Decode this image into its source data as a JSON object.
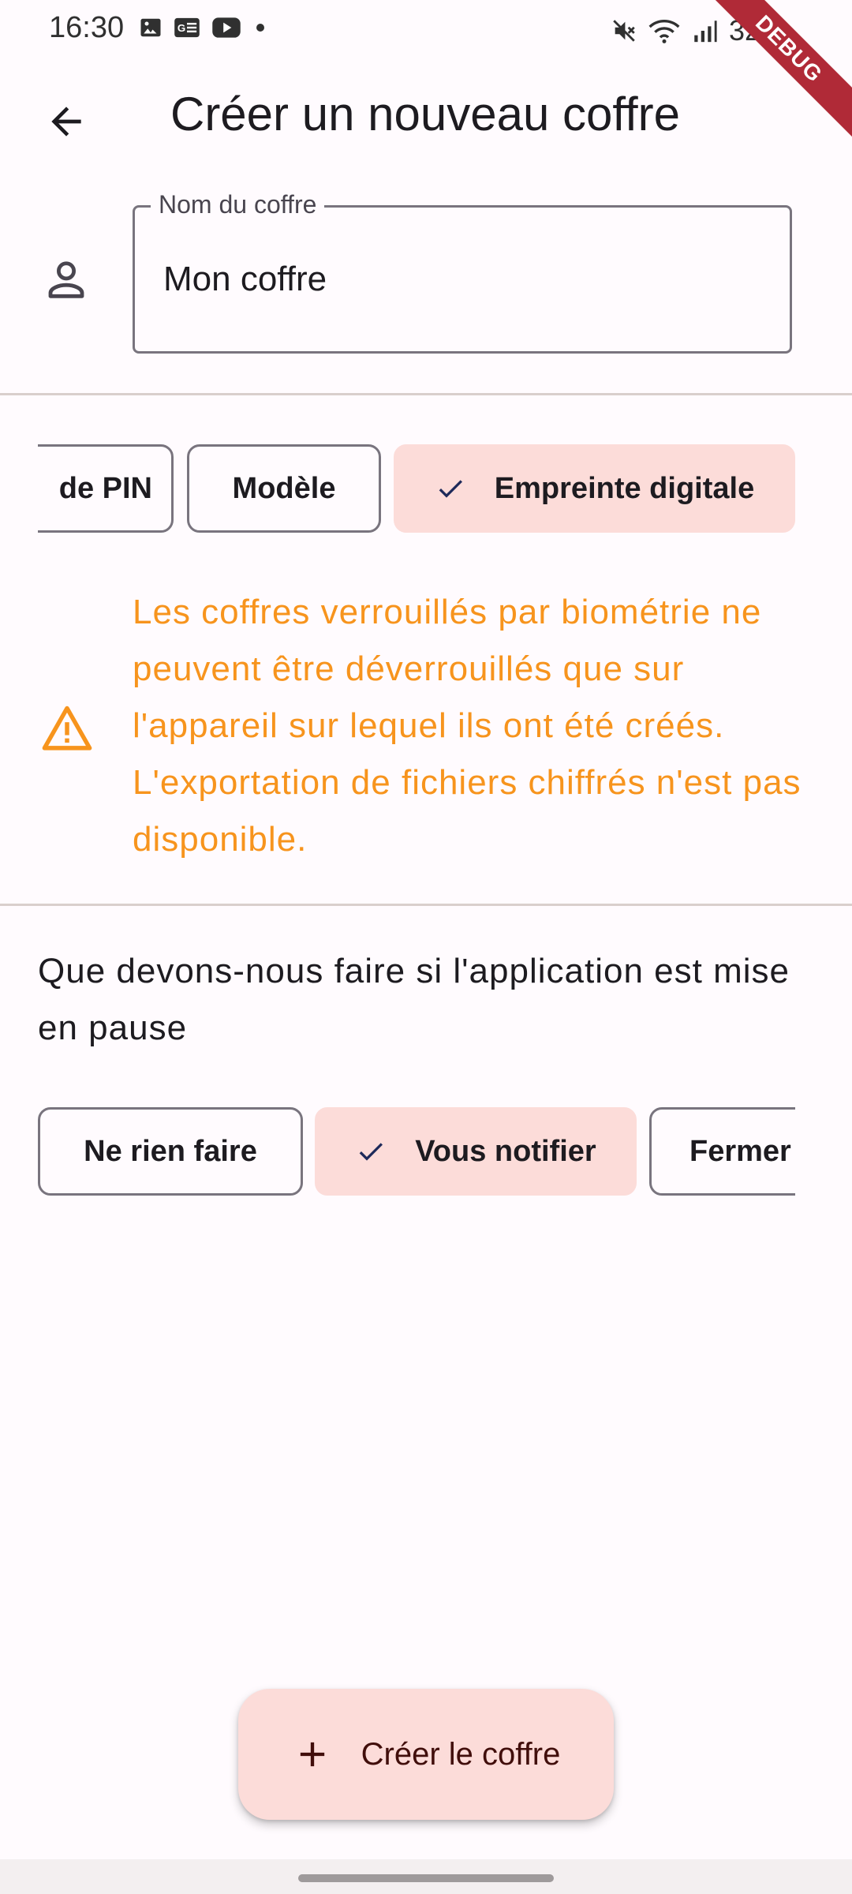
{
  "status_bar": {
    "time": "16:30",
    "battery": "32%",
    "debug_label": "DEBUG"
  },
  "app_bar": {
    "title": "Créer un nouveau coffre"
  },
  "name_field": {
    "label": "Nom du coffre",
    "value": "Mon coffre"
  },
  "lock_chips": [
    {
      "label": "de PIN",
      "selected": false
    },
    {
      "label": "Modèle",
      "selected": false
    },
    {
      "label": "Empreinte digitale",
      "selected": true
    }
  ],
  "warning": {
    "text": "Les coffres verrouillés par biométrie ne peuvent être déverrouillés que sur l'appareil sur lequel ils ont été créés. L'exportation de fichiers chiffrés n'est pas disponible.",
    "color": "#f7941d"
  },
  "pause": {
    "question": "Que devons-nous faire si l'application est mise en pause",
    "chips": [
      {
        "label": "Ne rien faire",
        "selected": false
      },
      {
        "label": "Vous notifier",
        "selected": true
      },
      {
        "label": "Fermer",
        "selected": false
      }
    ]
  },
  "fab": {
    "label": "Créer le coffre"
  },
  "colors": {
    "background": "#fffbfe",
    "selected_chip": "#fcdcd9",
    "outline": "#79747e"
  }
}
